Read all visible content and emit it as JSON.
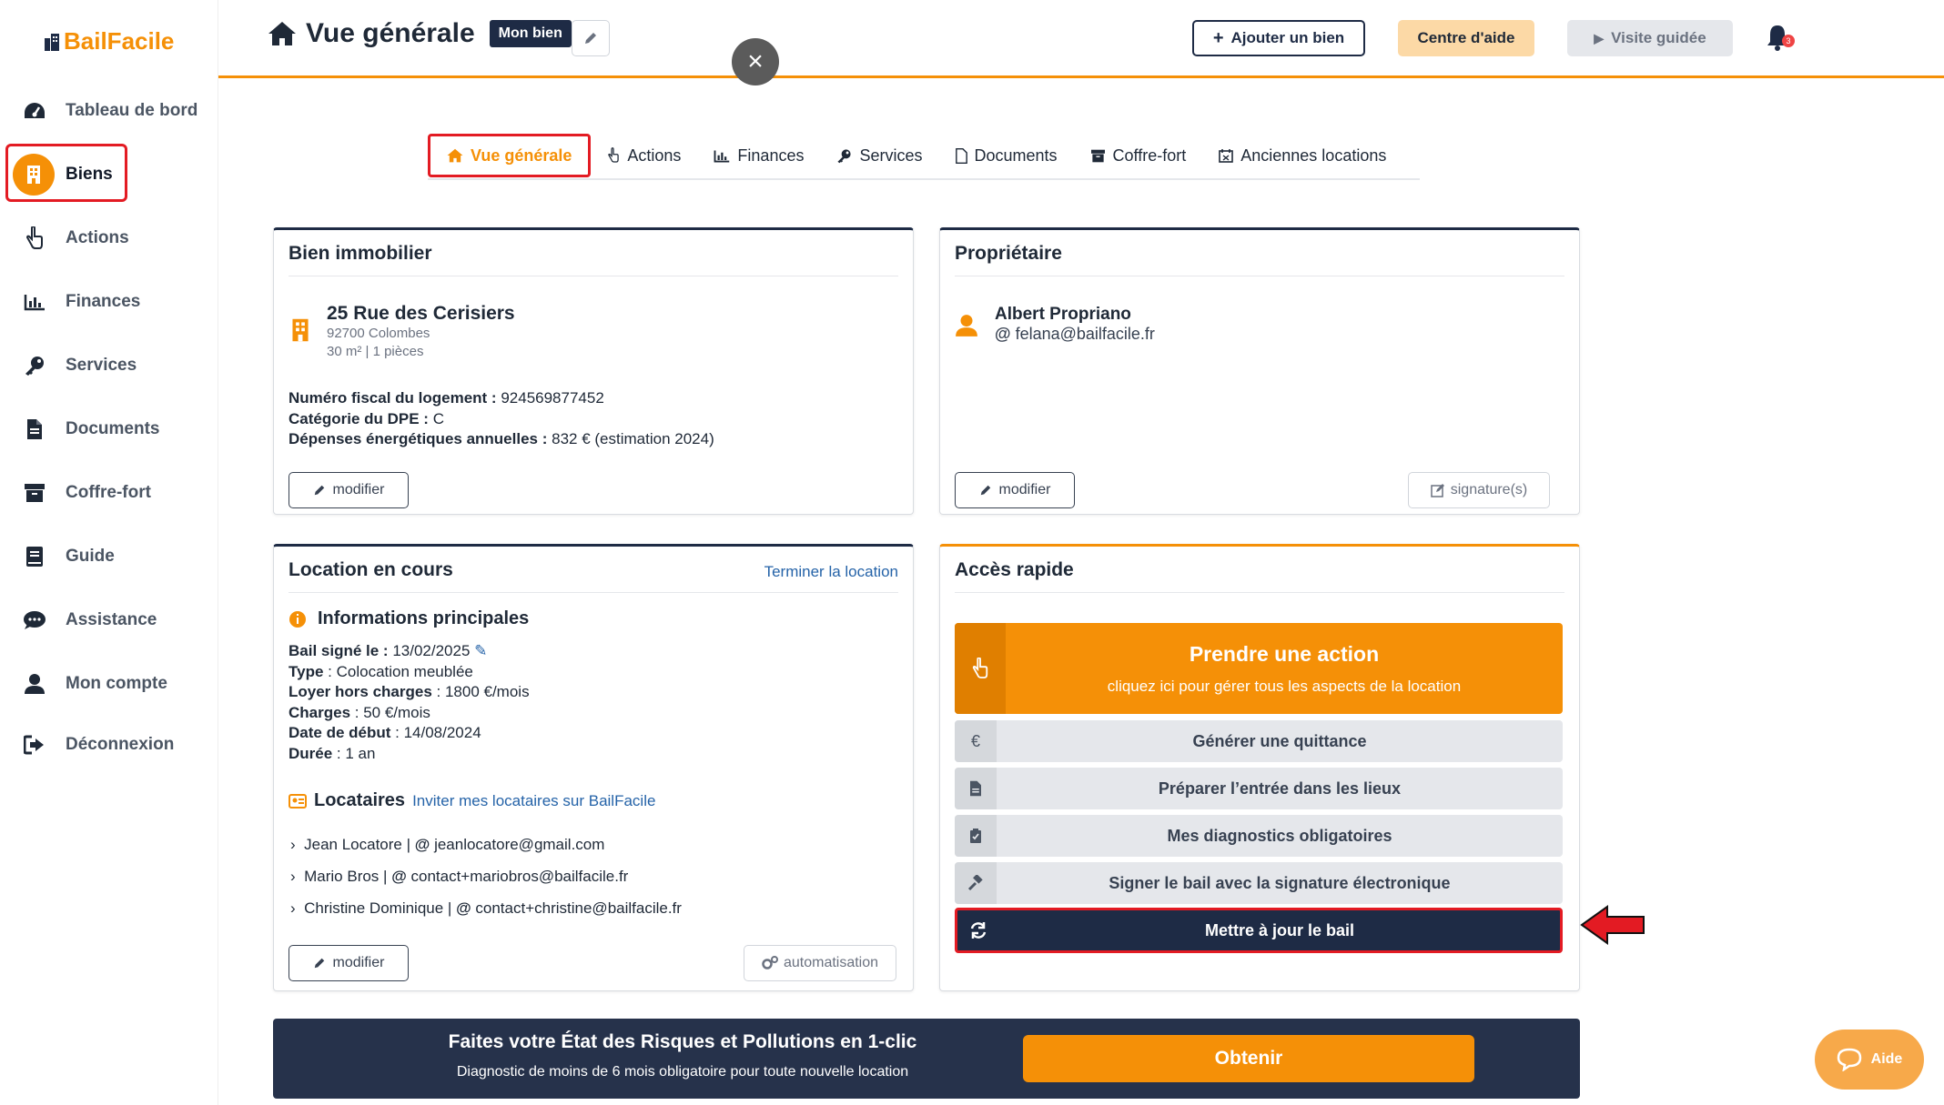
{
  "app": {
    "logo": "BailFacile"
  },
  "sidebar": {
    "items": [
      {
        "label": "Tableau de bord"
      },
      {
        "label": "Biens"
      },
      {
        "label": "Actions"
      },
      {
        "label": "Finances"
      },
      {
        "label": "Services"
      },
      {
        "label": "Documents"
      },
      {
        "label": "Coffre-fort"
      },
      {
        "label": "Guide"
      },
      {
        "label": "Assistance"
      },
      {
        "label": "Mon compte"
      },
      {
        "label": "Déconnexion"
      }
    ]
  },
  "header": {
    "title": "Vue générale",
    "badge": "Mon bien",
    "add_button": "Ajouter un bien",
    "help_button": "Centre d'aide",
    "tour_button": "Visite guidée",
    "notif_count": "3"
  },
  "tabs": [
    {
      "label": "Vue générale"
    },
    {
      "label": "Actions"
    },
    {
      "label": "Finances"
    },
    {
      "label": "Services"
    },
    {
      "label": "Documents"
    },
    {
      "label": "Coffre-fort"
    },
    {
      "label": "Anciennes locations"
    }
  ],
  "property": {
    "card_title": "Bien immobilier",
    "address": "25 Rue des Cerisiers",
    "city": "92700 Colombes",
    "size": "30 m² | 1 pièces",
    "fiscal_label": "Numéro fiscal du logement :",
    "fiscal_value": "924569877452",
    "dpe_label": "Catégorie du DPE :",
    "dpe_value": "C",
    "energy_label": "Dépenses énergétiques annuelles :",
    "energy_value": "832 € (estimation 2024)",
    "edit_button": "modifier"
  },
  "owner": {
    "card_title": "Propriétaire",
    "name": "Albert Propriano",
    "email": "felana@bailfacile.fr",
    "edit_button": "modifier",
    "signature_button": "signature(s)"
  },
  "rental": {
    "card_title": "Location en cours",
    "end_link": "Terminer la location",
    "info_title": "Informations principales",
    "bail_label": "Bail signé le :",
    "bail_value": "13/02/2025",
    "type_label": "Type",
    "type_value": ": Colocation meublée",
    "rent_label": "Loyer hors charges",
    "rent_value": ": 1800 €/mois",
    "charges_label": "Charges",
    "charges_value": ": 50 €/mois",
    "start_label": "Date de début",
    "start_value": ": 14/08/2024",
    "duration_label": "Durée",
    "duration_value": ": 1 an",
    "tenants_title": "Locataires",
    "invite_link": "Inviter mes locataires sur BailFacile",
    "tenants": [
      {
        "name": "Jean Locatore",
        "email": "jeanlocatore@gmail.com"
      },
      {
        "name": "Mario Bros",
        "email": "contact+mariobros@bailfacile.fr"
      },
      {
        "name": "Christine Dominique",
        "email": "contact+christine@bailfacile.fr"
      }
    ],
    "edit_button": "modifier",
    "automation_button": "automatisation"
  },
  "quick_access": {
    "card_title": "Accès rapide",
    "main_title": "Prendre une action",
    "main_sub": "cliquez ici pour gérer tous les aspects de la location",
    "rows": [
      {
        "label": "Générer une quittance",
        "icon": "€"
      },
      {
        "label": "Préparer l’entrée dans les lieux"
      },
      {
        "label": "Mes diagnostics obligatoires"
      },
      {
        "label": "Signer le bail avec la signature électronique"
      },
      {
        "label": "Mettre à jour le bail"
      }
    ]
  },
  "banner": {
    "title": "Faites votre État des Risques et Pollutions en 1-clic",
    "subtitle": "Diagnostic de moins de 6 mois obligatoire pour toute nouvelle location",
    "button": "Obtenir"
  },
  "help_widget": {
    "label": "Aide"
  },
  "colors": {
    "accent": "#f59007",
    "navy": "#1e2b45",
    "highlight": "#e31b23"
  }
}
